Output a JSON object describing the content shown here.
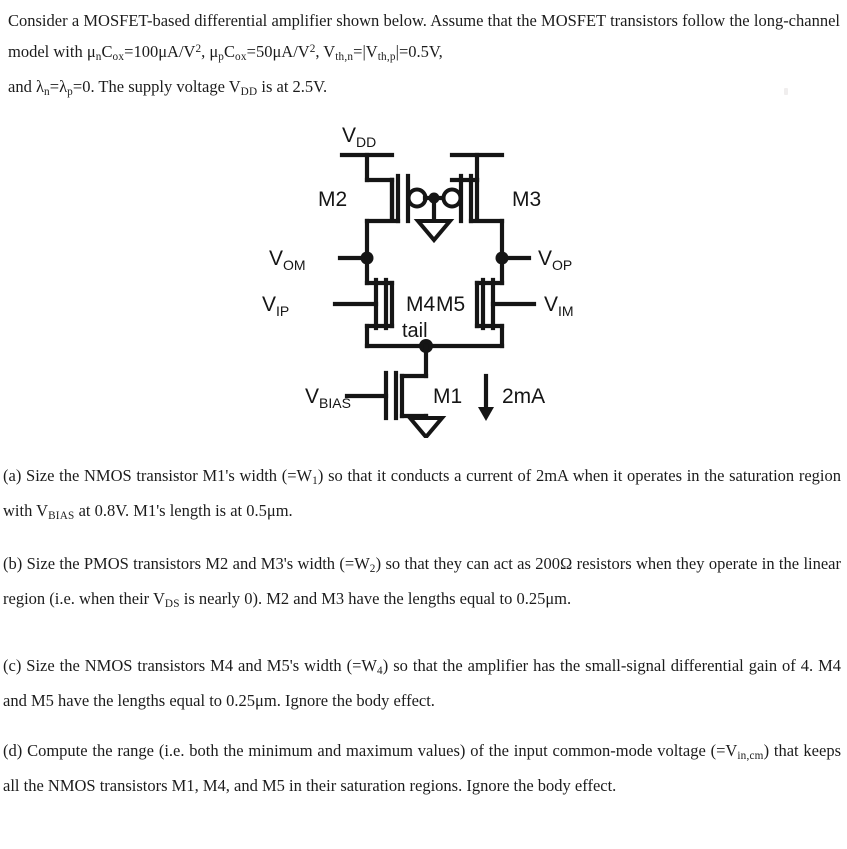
{
  "document": {
    "intro": {
      "line1_a": "Consider a MOSFET-based differential amplifier shown below. Assume that the MOSFET transistors follow the long-channel model with ",
      "mu_n_cox_label": "C",
      "mu_n_value": "=100μA/V",
      "mu_p_value": "=50μA/V",
      "vth_mid": "=|",
      "vth_end": "|=0.5V,",
      "lambda_text": "and ",
      "lambda_eq": "=0. The supply voltage ",
      "supply_tail": " is at 2.5V.",
      "sym_mu_n": "μ",
      "sym_mu_p": "μ",
      "sym_lambda": "λ",
      "sub_n": "n",
      "sub_p": "p",
      "sub_ox": "ox",
      "sub_thn": "th,n",
      "sub_thp": "th,p",
      "sub_dd": "DD",
      "sup_two": "2",
      "v_letter": "V",
      "comma_sp": ", "
    },
    "questions": [
      {
        "id": "a",
        "marker": "(a)",
        "text_1": "Size the NMOS transistor M1's width (=W",
        "sub_1": "1",
        "text_2": ") so that it conducts a current of 2mA when it operates in the saturation region with V",
        "sub_2": "BIAS",
        "text_3": " at 0.8V. M1's length is at 0.5μm."
      },
      {
        "id": "b",
        "marker": "(b)",
        "text_1": "Size the PMOS transistors M2 and M3's width (=W",
        "sub_1": "2",
        "text_2": ") so that they can act as 200Ω resistors when they operate in the linear region (i.e. when their V",
        "sub_2": "DS",
        "text_3": " is nearly 0). M2 and M3 have the lengths equal to 0.25μm."
      },
      {
        "id": "c",
        "marker": "(c)",
        "text_1": "Size the NMOS transistors M4 and M5's width (=W",
        "sub_1": "4",
        "text_2": ") so that the amplifier has the small-signal differential gain of 4. M4 and M5 have the lengths equal to 0.25μm. Ignore the body effect.",
        "sub_2": "",
        "text_3": ""
      },
      {
        "id": "d",
        "marker": "(d)",
        "text_1": "Compute the range (i.e. both the minimum and maximum values) of the input common-mode voltage (=V",
        "sub_1": "in,cm",
        "text_2": ") that keeps all the NMOS transistors M1, M4, and M5 in their saturation regions. Ignore the body effect.",
        "sub_2": "",
        "text_3": ""
      }
    ]
  },
  "circuit": {
    "title": "MOSFET differential amplifier schematic",
    "labels": {
      "vdd": "V",
      "vdd_sub": "DD",
      "m2": "M2",
      "m3": "M3",
      "m4": "M4",
      "m5": "M5",
      "m1": "M1",
      "vom": "V",
      "vom_sub": "OM",
      "vop": "V",
      "vop_sub": "OP",
      "vip": "V",
      "vip_sub": "IP",
      "vim": "V",
      "vim_sub": "IM",
      "vbias": "V",
      "vbias_sub": "BIAS",
      "tail": "tail",
      "current": "2mA"
    },
    "colors": {
      "wire": "#151515",
      "background": "#ffffff",
      "text": "#151515"
    }
  }
}
